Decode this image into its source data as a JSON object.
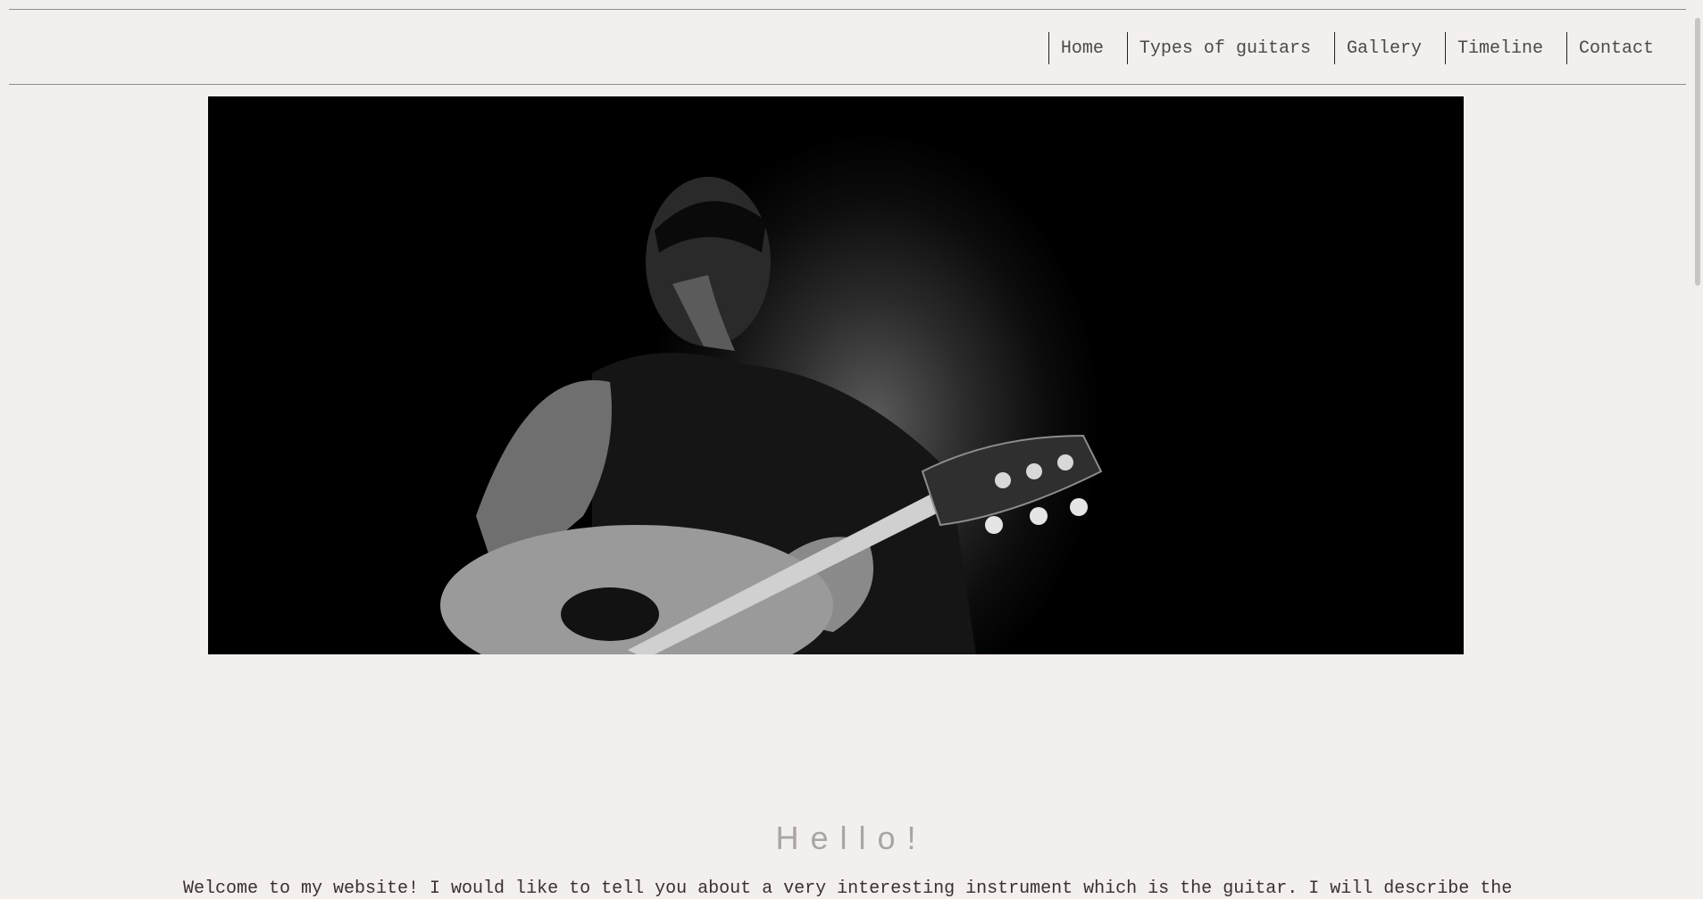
{
  "nav": {
    "items": [
      {
        "label": "Home"
      },
      {
        "label": "Types of guitars"
      },
      {
        "label": "Gallery"
      },
      {
        "label": "Timeline"
      },
      {
        "label": "Contact"
      }
    ]
  },
  "hero": {
    "image_subject": "Black and white photo of a man playing an acoustic guitar"
  },
  "main": {
    "heading": "Hello!",
    "intro": "Welcome to my website! I would like to tell you about a very interesting instrument which is the guitar. I will describe the"
  }
}
